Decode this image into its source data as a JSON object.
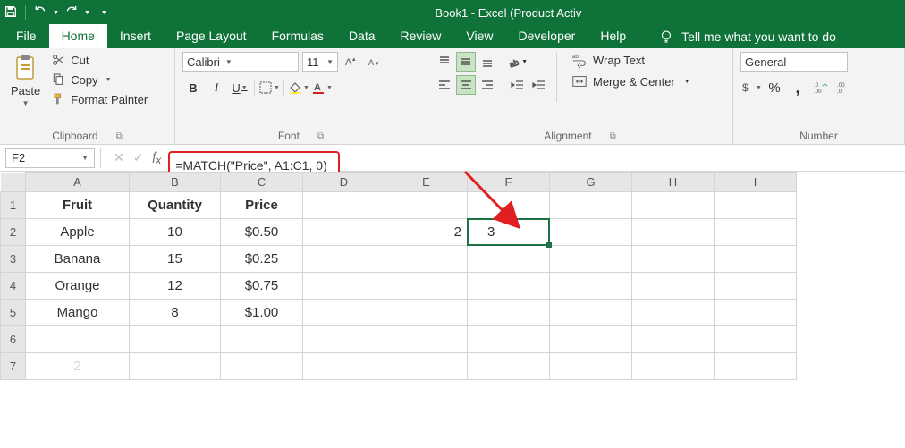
{
  "title": "Book1  -  Excel (Product Activ",
  "tabs": [
    "File",
    "Home",
    "Insert",
    "Page Layout",
    "Formulas",
    "Data",
    "Review",
    "View",
    "Developer",
    "Help"
  ],
  "active_tab": "Home",
  "tellme": "Tell me what you want to do",
  "clipboard": {
    "paste": "Paste",
    "cut": "Cut",
    "copy": "Copy",
    "format_painter": "Format Painter",
    "label": "Clipboard"
  },
  "font": {
    "name": "Calibri",
    "size": "11",
    "label": "Font"
  },
  "alignment": {
    "wrap": "Wrap Text",
    "merge": "Merge & Center",
    "label": "Alignment"
  },
  "number": {
    "format": "General",
    "label": "Number"
  },
  "namebox": "F2",
  "formula": "=MATCH(\"Price\", A1:C1, 0)",
  "columns": [
    "A",
    "B",
    "C",
    "D",
    "E",
    "F",
    "G",
    "H",
    "I"
  ],
  "rows": [
    "1",
    "2",
    "3",
    "4",
    "5",
    "6",
    "7"
  ],
  "cells": {
    "A1": "Fruit",
    "B1": "Quantity",
    "C1": "Price",
    "A2": "Apple",
    "B2": "10",
    "C2": "$0.50",
    "E2": "2",
    "F2": "3",
    "A3": "Banana",
    "B3": "15",
    "C3": "$0.25",
    "A4": "Orange",
    "B4": "12",
    "C4": "$0.75",
    "A5": "Mango",
    "B5": "8",
    "C5": "$1.00",
    "A7_hint": "2"
  },
  "selected_cell": "F2"
}
